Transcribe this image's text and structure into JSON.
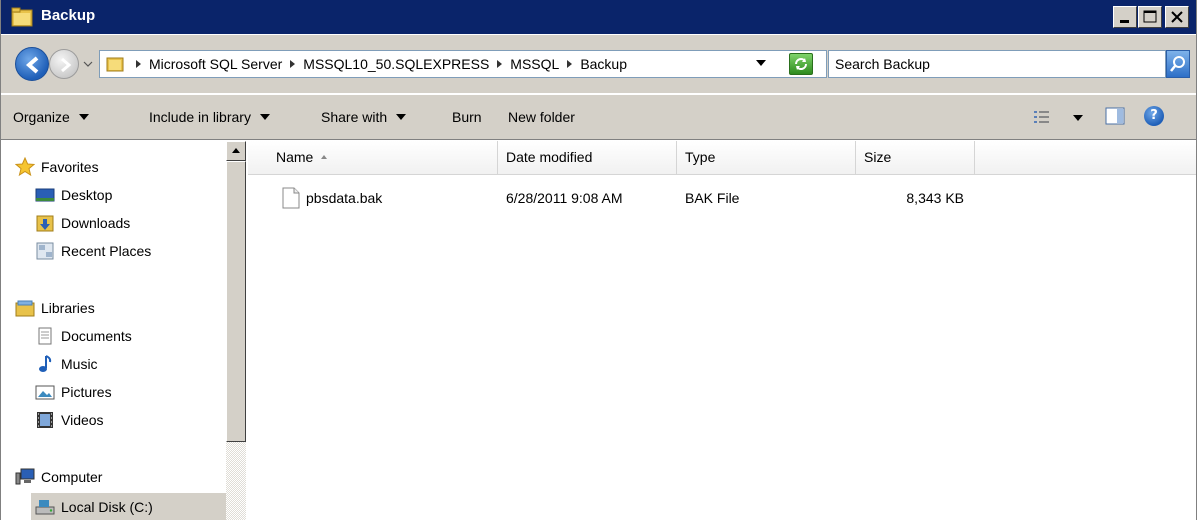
{
  "window": {
    "title": "Backup"
  },
  "address": {
    "crumbs": [
      "Microsoft SQL Server",
      "MSSQL10_50.SQLEXPRESS",
      "MSSQL",
      "Backup"
    ]
  },
  "search": {
    "placeholder": "Search Backup"
  },
  "toolbar": {
    "organize": "Organize",
    "include_in_library": "Include in library",
    "share_with": "Share with",
    "burn": "Burn",
    "new_folder": "New folder"
  },
  "nav": {
    "favorites": "Favorites",
    "desktop": "Desktop",
    "downloads": "Downloads",
    "recent_places": "Recent Places",
    "libraries": "Libraries",
    "documents": "Documents",
    "music": "Music",
    "pictures": "Pictures",
    "videos": "Videos",
    "computer": "Computer",
    "local_disk": "Local Disk (C:)"
  },
  "columns": {
    "name": "Name",
    "date_modified": "Date modified",
    "type": "Type",
    "size": "Size"
  },
  "files": [
    {
      "name": "pbsdata.bak",
      "date_modified": "6/28/2011 9:08 AM",
      "type": "BAK File",
      "size": "8,343 KB"
    }
  ],
  "colors": {
    "titlebar": "#0a246a",
    "chrome": "#d4d0c8"
  }
}
